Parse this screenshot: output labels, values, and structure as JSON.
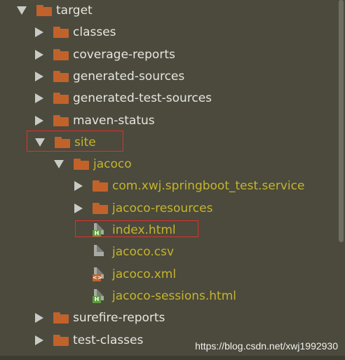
{
  "tree": [
    {
      "label": "target",
      "depth": 0,
      "arrow": "down",
      "icon": "folder",
      "color": "normal"
    },
    {
      "label": "classes",
      "depth": 1,
      "arrow": "right",
      "icon": "folder",
      "color": "normal"
    },
    {
      "label": "coverage-reports",
      "depth": 1,
      "arrow": "right",
      "icon": "folder",
      "color": "normal"
    },
    {
      "label": "generated-sources",
      "depth": 1,
      "arrow": "right",
      "icon": "folder",
      "color": "normal"
    },
    {
      "label": "generated-test-sources",
      "depth": 1,
      "arrow": "right",
      "icon": "folder",
      "color": "normal"
    },
    {
      "label": "maven-status",
      "depth": 1,
      "arrow": "right",
      "icon": "folder",
      "color": "normal"
    },
    {
      "label": "site",
      "depth": 1,
      "arrow": "down",
      "icon": "folder",
      "color": "olive"
    },
    {
      "label": "jacoco",
      "depth": 2,
      "arrow": "down",
      "icon": "folder",
      "color": "olive"
    },
    {
      "label": "com.xwj.springboot_test.service",
      "depth": 3,
      "arrow": "right",
      "icon": "folder",
      "color": "olive"
    },
    {
      "label": "jacoco-resources",
      "depth": 3,
      "arrow": "right",
      "icon": "folder",
      "color": "olive"
    },
    {
      "label": "index.html",
      "depth": 3,
      "arrow": "none",
      "icon": "html-file",
      "color": "olive"
    },
    {
      "label": "jacoco.csv",
      "depth": 3,
      "arrow": "none",
      "icon": "text-file",
      "color": "olive"
    },
    {
      "label": "jacoco.xml",
      "depth": 3,
      "arrow": "none",
      "icon": "xml-file",
      "color": "olive"
    },
    {
      "label": "jacoco-sessions.html",
      "depth": 3,
      "arrow": "none",
      "icon": "html-file",
      "color": "olive"
    },
    {
      "label": "surefire-reports",
      "depth": 1,
      "arrow": "right",
      "icon": "folder",
      "color": "normal"
    },
    {
      "label": "test-classes",
      "depth": 1,
      "arrow": "right",
      "icon": "folder",
      "color": "normal"
    }
  ],
  "watermark": "https://blog.csdn.net/xwj1992930",
  "colors": {
    "background": "#4b4a3c",
    "folder": "#c2622b",
    "olive_text": "#c5b42d",
    "highlight": "#e03030"
  }
}
